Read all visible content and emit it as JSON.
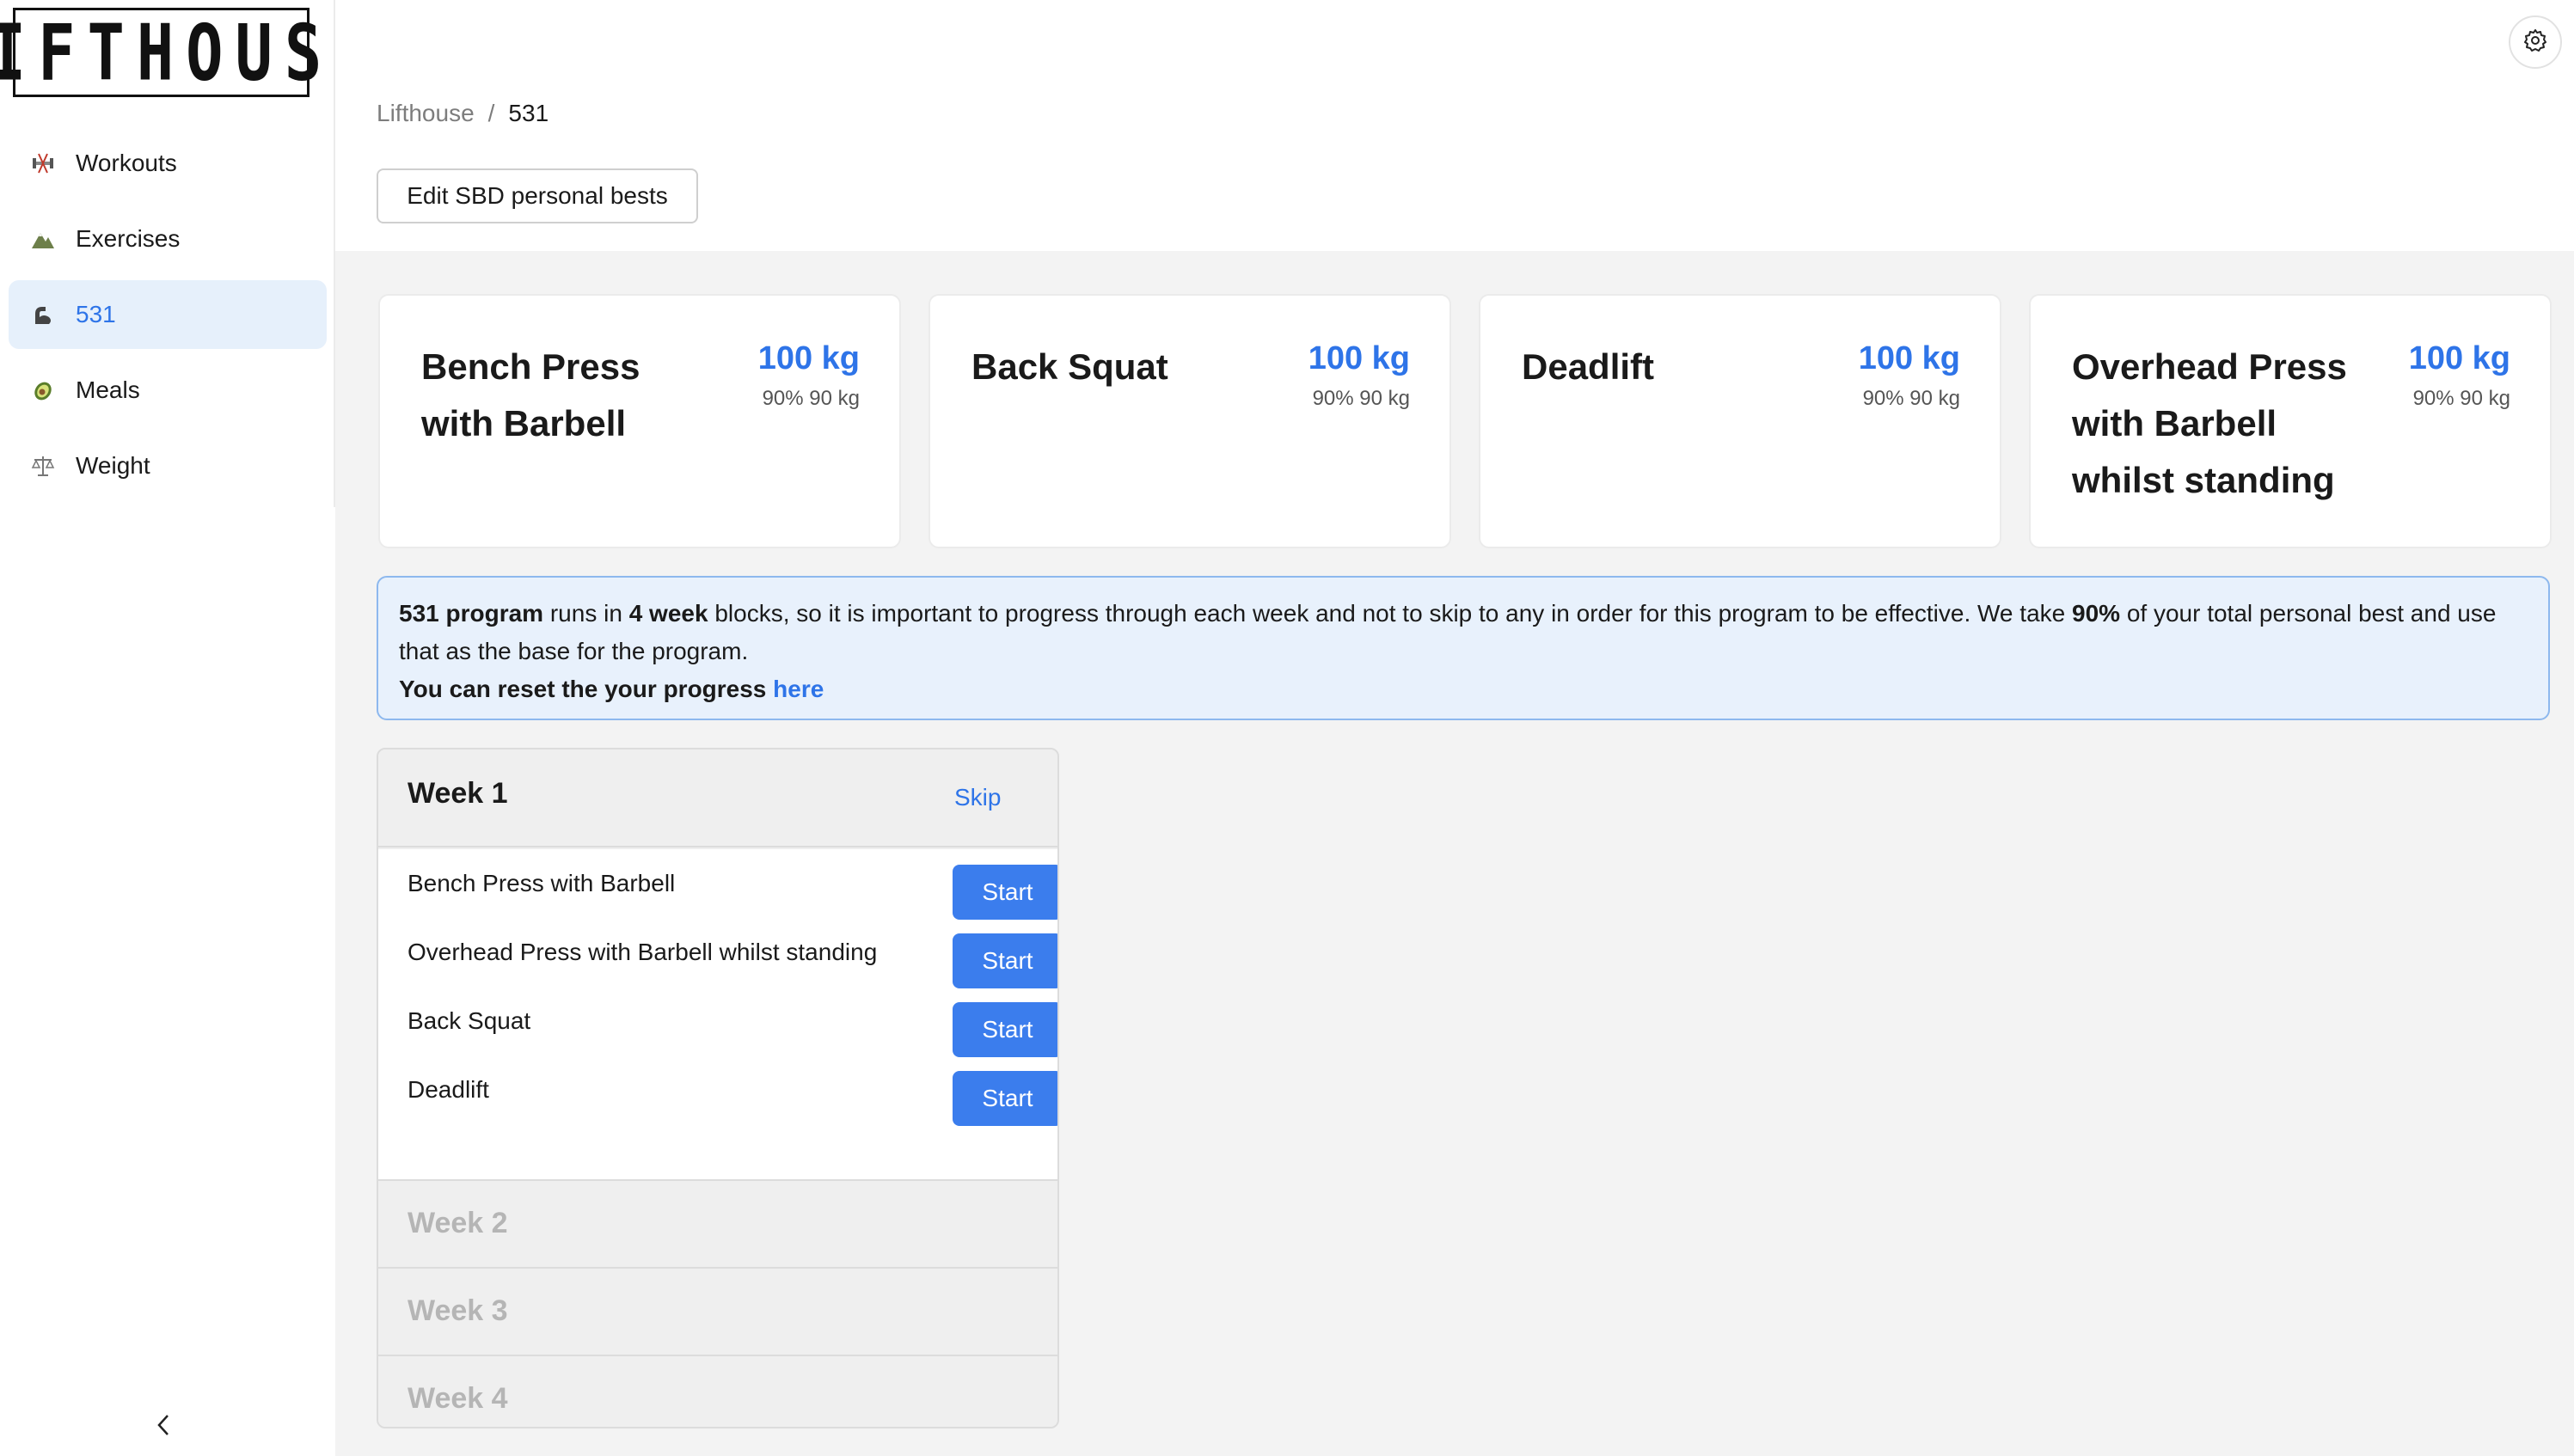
{
  "app": {
    "logo_text": "LIFTHOUSE"
  },
  "sidebar": {
    "items": [
      {
        "label": "Workouts",
        "icon": "dumbbell-icon",
        "active": false
      },
      {
        "label": "Exercises",
        "icon": "mountain-icon",
        "active": false
      },
      {
        "label": "531",
        "icon": "flexed-arm-icon",
        "active": true
      },
      {
        "label": "Meals",
        "icon": "avocado-icon",
        "active": false
      },
      {
        "label": "Weight",
        "icon": "scales-icon",
        "active": false
      }
    ],
    "collapse_icon": "chevron-left-icon"
  },
  "header": {
    "breadcrumb": {
      "home": "Lifthouse",
      "separator": "/",
      "current": "531"
    },
    "edit_button_label": "Edit SBD personal bests",
    "settings_icon": "gear-icon"
  },
  "cards": [
    {
      "title": "Bench Press with Barbell",
      "weight": "100 kg",
      "sub": "90% 90 kg"
    },
    {
      "title": "Back Squat",
      "weight": "100 kg",
      "sub": "90% 90 kg"
    },
    {
      "title": "Deadlift",
      "weight": "100 kg",
      "sub": "90% 90 kg"
    },
    {
      "title": "Overhead Press with Barbell whilst standing",
      "weight": "100 kg",
      "sub": "90% 90 kg"
    }
  ],
  "info": {
    "bold_program": "531 program",
    "text_runs_in": " runs in ",
    "bold_weeks": "4 week",
    "text_middle": " blocks, so it is important to progress through each week and not to skip to any in order for this program to be effective. We take ",
    "bold_percent": "90%",
    "text_end": " of your total personal best and use that as the base for the program.",
    "reset_text": "You can reset the your progress ",
    "reset_link": "here"
  },
  "weeks": {
    "active": {
      "title": "Week 1",
      "skip_label": "Skip",
      "exercises": [
        {
          "name": "Bench Press with Barbell",
          "button": "Start"
        },
        {
          "name": "Overhead Press with Barbell whilst standing",
          "button": "Start"
        },
        {
          "name": "Back Squat",
          "button": "Start"
        },
        {
          "name": "Deadlift",
          "button": "Start"
        }
      ]
    },
    "collapsed": [
      "Week 2",
      "Week 3",
      "Week 4"
    ]
  },
  "colors": {
    "accent": "#3b7ded",
    "link": "#2e74e8",
    "active_bg": "#e6f0fb",
    "info_bg": "#e8f1fc",
    "info_border": "#8db8ee"
  }
}
